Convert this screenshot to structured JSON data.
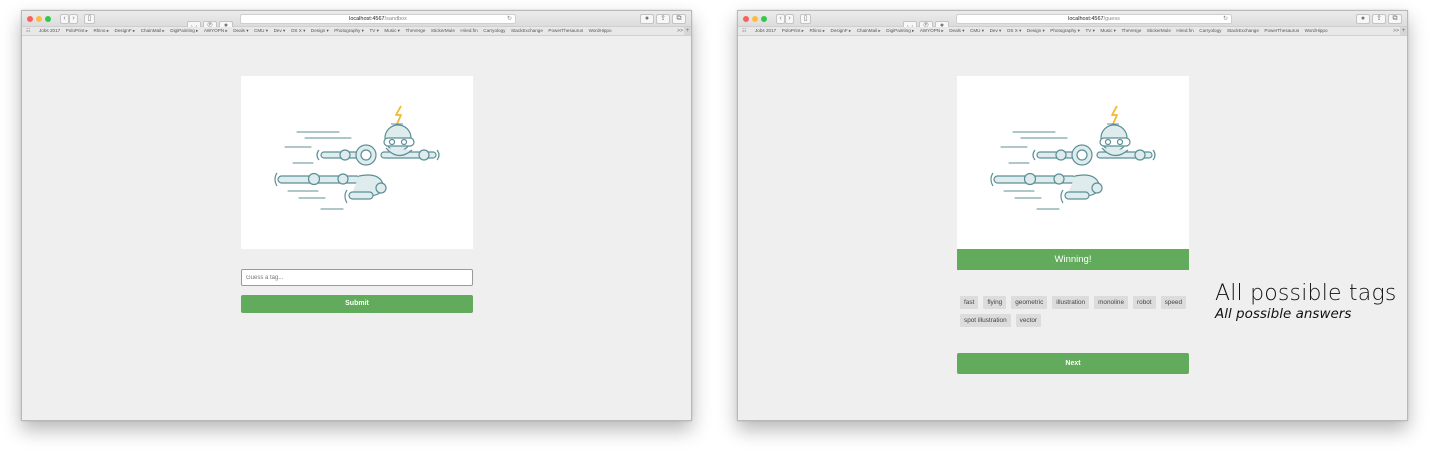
{
  "bookmarks": [
    "Jobs 2017",
    "PoloPrint ▸",
    "Rhino ▸",
    "DesignF ▸",
    "ChainMail ▸",
    "DigiPainting ▸",
    "AWYOPN ▸",
    "Deals ▾",
    "CMU ▾",
    "Dev ▾",
    "OS X ▾",
    "Design ▾",
    "Photography ▾",
    "TV ▾",
    "Music ▾",
    "TheVerge",
    "StickerMule",
    "Hired.fm",
    "Carryology",
    "StackExchange",
    "PowerThesaurus",
    "WordHippo"
  ],
  "bookmarks_more": ">>",
  "left_window": {
    "url_host": "localhost:4567",
    "url_path": "/sandbox",
    "input_placeholder": "Guess a tag...",
    "submit_label": "Submit"
  },
  "right_window": {
    "url_host": "localhost:4567",
    "url_path": "/guess",
    "result_banner": "Winning!",
    "tags": [
      "fast",
      "flying",
      "geometric",
      "illustration",
      "monoline",
      "robot",
      "speed",
      "spot illustration",
      "vector"
    ],
    "next_label": "Next"
  },
  "annotation": {
    "title": "All possible tags",
    "subtitle": "All possible answers"
  },
  "colors": {
    "accent_green": "#62aa5c",
    "robot_fill": "#dfecee",
    "robot_stroke": "#5b8f96",
    "bolt": "#f5b82e"
  }
}
